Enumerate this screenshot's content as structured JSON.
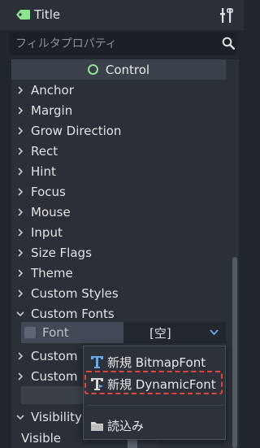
{
  "header": {
    "title": "Title",
    "tag_icon": "tag-icon",
    "tools_icon": "tools-icon"
  },
  "filter": {
    "placeholder": "フィルタプロパティ",
    "value": "",
    "icon": "search-icon"
  },
  "section": {
    "label": "Control",
    "icon": "control-node-icon",
    "accent": "#8fe28f"
  },
  "properties": [
    {
      "label": "Anchor",
      "expanded": false
    },
    {
      "label": "Margin",
      "expanded": false
    },
    {
      "label": "Grow Direction",
      "expanded": false
    },
    {
      "label": "Rect",
      "expanded": false
    },
    {
      "label": "Hint",
      "expanded": false
    },
    {
      "label": "Focus",
      "expanded": false
    },
    {
      "label": "Mouse",
      "expanded": false
    },
    {
      "label": "Input",
      "expanded": false
    },
    {
      "label": "Size Flags",
      "expanded": false
    },
    {
      "label": "Theme",
      "expanded": false
    },
    {
      "label": "Custom Styles",
      "expanded": false
    },
    {
      "label": "Custom Fonts",
      "expanded": true
    }
  ],
  "font_property": {
    "label": "Font",
    "value": "[空]",
    "checked": false
  },
  "truncated_rows": [
    {
      "label": "Custom"
    },
    {
      "label": "Custom"
    }
  ],
  "visibility": {
    "label": "Visibility",
    "visible_label": "Visible"
  },
  "context_menu": {
    "items": [
      {
        "label": "新規 BitmapFont",
        "icon": "bitmap-font-icon"
      },
      {
        "label": "新規 DynamicFont",
        "icon": "dynamic-font-icon",
        "highlighted": true
      },
      {
        "label": "読込み",
        "icon": "folder-icon"
      }
    ],
    "highlight_color": "#e0443a"
  }
}
